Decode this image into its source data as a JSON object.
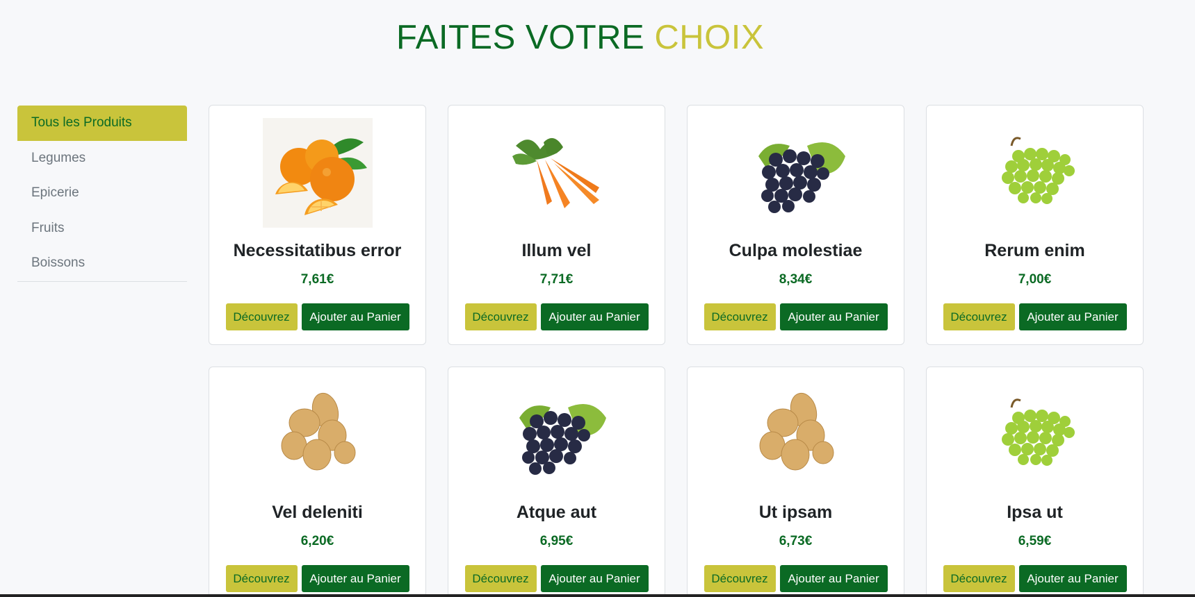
{
  "heading": {
    "part1": "FAITES VOTRE",
    "part2": "CHOIX"
  },
  "colors": {
    "brand_green": "#0b6a24",
    "brand_yellow": "#c9c43b"
  },
  "categories": [
    {
      "label": "Tous les Produits",
      "active": true
    },
    {
      "label": "Legumes",
      "active": false
    },
    {
      "label": "Epicerie",
      "active": false
    },
    {
      "label": "Fruits",
      "active": false
    },
    {
      "label": "Boissons",
      "active": false
    }
  ],
  "buttons": {
    "discover": "Découvrez",
    "add_to_cart": "Ajouter au Panier"
  },
  "products": [
    {
      "name": "Necessitatibus error",
      "price": "7,61€",
      "image": "oranges-icon"
    },
    {
      "name": "Illum vel",
      "price": "7,71€",
      "image": "carrots-icon"
    },
    {
      "name": "Culpa molestiae",
      "price": "8,34€",
      "image": "black-grapes-icon"
    },
    {
      "name": "Rerum enim",
      "price": "7,00€",
      "image": "green-grapes-icon"
    },
    {
      "name": "Vel deleniti",
      "price": "6,20€",
      "image": "potatoes-icon"
    },
    {
      "name": "Atque aut",
      "price": "6,95€",
      "image": "black-grapes-icon"
    },
    {
      "name": "Ut ipsam",
      "price": "6,73€",
      "image": "potatoes-icon"
    },
    {
      "name": "Ipsa ut",
      "price": "6,59€",
      "image": "green-grapes-icon"
    }
  ]
}
